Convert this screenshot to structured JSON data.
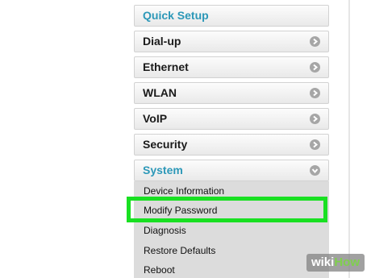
{
  "menu": {
    "items": [
      {
        "label": "Quick Setup",
        "accent": true,
        "icon": ""
      },
      {
        "label": "Dial-up",
        "icon": "chevron-right-icon"
      },
      {
        "label": "Ethernet",
        "icon": "chevron-right-icon"
      },
      {
        "label": "WLAN",
        "icon": "chevron-right-icon"
      },
      {
        "label": "VoIP",
        "icon": "chevron-right-icon"
      },
      {
        "label": "Security",
        "icon": "chevron-right-icon"
      },
      {
        "label": "System",
        "accent": true,
        "expanded": true,
        "icon": "chevron-down-icon"
      }
    ],
    "submenu": [
      {
        "label": "Device Information"
      },
      {
        "label": "Modify Password",
        "highlighted": true
      },
      {
        "label": "Diagnosis"
      },
      {
        "label": "Restore Defaults"
      },
      {
        "label": "Reboot"
      }
    ]
  },
  "watermark": {
    "wiki": "wiki",
    "how": "How"
  },
  "colors": {
    "accent": "#2c98b8",
    "highlight": "#19e022",
    "submenu_bg": "#dcdcdc"
  }
}
